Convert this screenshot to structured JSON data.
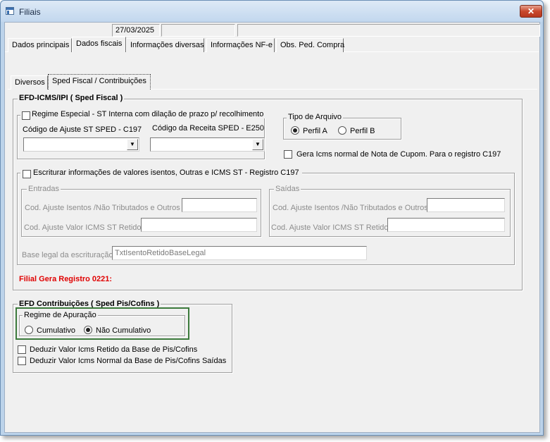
{
  "window": {
    "title": "Filiais",
    "close_label": "✕"
  },
  "header": {
    "date": "27/03/2025",
    "field2": "",
    "field3": ""
  },
  "main_tabs": [
    {
      "label": "Dados principais"
    },
    {
      "label": "Dados fiscais"
    },
    {
      "label": "Informações diversas"
    },
    {
      "label": "Informações NF-e"
    },
    {
      "label": "Obs. Ped. Compra"
    }
  ],
  "sub_tabs": [
    {
      "label": "Diversos"
    },
    {
      "label": "Sped Fiscal / Contribuições"
    }
  ],
  "efd_icms": {
    "title": "EFD-ICMS/IPI ( Sped Fiscal )",
    "regime_especial": {
      "label": "Regime Especial - ST Interna com dilação de prazo p/ recolhimento",
      "checked": false,
      "ajuste_label": "Código de Ajuste ST SPED - C197",
      "receita_label": "Código da Receita SPED - E250",
      "ajuste_value": "",
      "receita_value": ""
    },
    "tipo_arquivo": {
      "label": "Tipo de Arquivo",
      "options": [
        "Perfil A",
        "Perfil B"
      ],
      "selected": "Perfil A"
    },
    "gera_icms": {
      "label": "Gera Icms normal de Nota de Cupom. Para o registro C197",
      "checked": false
    },
    "escriturar": {
      "label": "Escriturar informações de valores isentos, Outras e  ICMS ST - Registro C197",
      "checked": false,
      "entradas": {
        "title": "Entradas",
        "isentos_label": "Cod. Ajuste Isentos /Não Tributados e Outros",
        "st_label": "Cod. Ajuste Valor ICMS ST Retido"
      },
      "saidas": {
        "title": "Saídas",
        "isentos_label": "Cod. Ajuste Isentos /Não Tributados e Outros",
        "st_label": "Cod. Ajuste Valor ICMS ST Retido"
      },
      "base_legal_label": "Base legal da escrituração",
      "base_legal_value": "TxtIsentoRetidoBaseLegal"
    },
    "filial_registro": "Filial Gera Registro 0221:"
  },
  "efd_contrib": {
    "title": "EFD Contribuições ( Sped Pis/Cofins )",
    "regime": {
      "label": "Regime de Apuração",
      "options": [
        "Cumulativo",
        "Não Cumulativo"
      ],
      "selected": "Não Cumulativo"
    },
    "deduzir_retido": {
      "label": "Deduzir Valor Icms Retido da Base de Pis/Cofins",
      "checked": false
    },
    "deduzir_normal": {
      "label": "Deduzir Valor Icms Normal da Base de Pis/Cofins Saídas",
      "checked": false
    }
  },
  "colors": {
    "accent_red": "#e00000",
    "focus_green": "#3c7a3c",
    "titlebar": "#c2d7ee"
  },
  "icons": {
    "dropdown": "chevron-down-icon",
    "close": "close-icon",
    "app": "window-icon"
  }
}
